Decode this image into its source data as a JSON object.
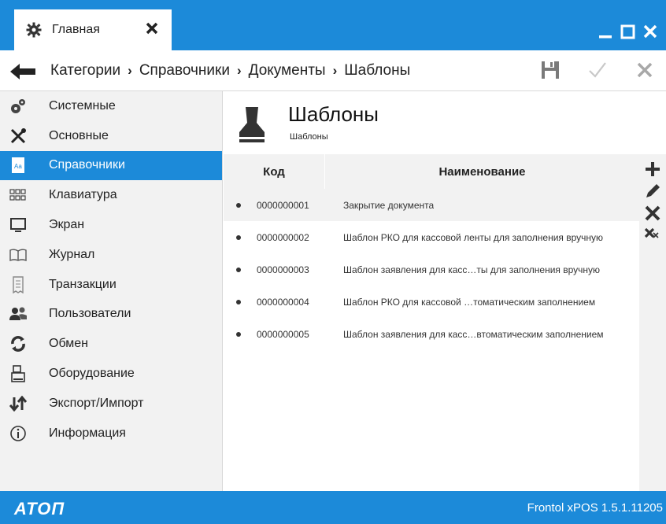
{
  "window": {
    "tab_label": "Главная",
    "accent": "#1c8ad9"
  },
  "breadcrumb": [
    "Категории",
    "Справочники",
    "Документы",
    "Шаблоны"
  ],
  "sidebar": {
    "items": [
      {
        "label": "Системные",
        "icon": "gears-icon"
      },
      {
        "label": "Основные",
        "icon": "tools-icon"
      },
      {
        "label": "Справочники",
        "icon": "reference-book-icon",
        "active": true
      },
      {
        "label": "Клавиатура",
        "icon": "keyboard-icon"
      },
      {
        "label": "Экран",
        "icon": "monitor-icon"
      },
      {
        "label": "Журнал",
        "icon": "open-book-icon"
      },
      {
        "label": "Транзакции",
        "icon": "receipt-icon"
      },
      {
        "label": "Пользователи",
        "icon": "users-icon"
      },
      {
        "label": "Обмен",
        "icon": "sync-icon"
      },
      {
        "label": "Оборудование",
        "icon": "cash-register-icon"
      },
      {
        "label": "Экспорт/Импорт",
        "icon": "export-import-icon"
      },
      {
        "label": "Информация",
        "icon": "info-icon"
      }
    ]
  },
  "page": {
    "title": "Шаблоны",
    "subtitle": "Шаблоны"
  },
  "table": {
    "columns": {
      "code": "Код",
      "name": "Наименование"
    },
    "rows": [
      {
        "code": "0000000001",
        "name": "Закрытие документа",
        "selected": true
      },
      {
        "code": "0000000002",
        "name": "Шаблон РКО для кассовой ленты для заполнения вручную"
      },
      {
        "code": "0000000003",
        "name": "Шаблон заявления для касс…ты для заполнения вручную"
      },
      {
        "code": "0000000004",
        "name": "Шаблон РКО для кассовой …томатическим заполнением"
      },
      {
        "code": "0000000005",
        "name": "Шаблон заявления для касс…втоматическим заполнением"
      }
    ]
  },
  "footer": {
    "logo": "ATOΠ",
    "version": "Frontol xPOS 1.5.1.11205"
  }
}
